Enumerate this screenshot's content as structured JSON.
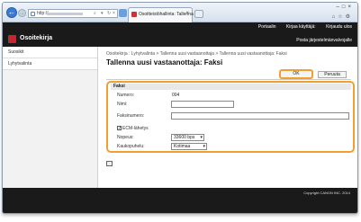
{
  "browser": {
    "address_scheme": "http://",
    "tab_title": "Osoitteistöhallinta: Tallenna ...",
    "icons": [
      "back-icon",
      "forward-icon",
      "close-icon",
      "home-icon",
      "star-icon",
      "gear-icon"
    ]
  },
  "header": {
    "top_links": [
      "Portaalin",
      "Kirjaa käyttäjä:",
      "Kirjaudu ulos"
    ],
    "app_title": "Osoitekirja",
    "top_right": "Posta järjestelmänvalvojalle"
  },
  "sidebar": {
    "items": [
      {
        "label": "Suosikit"
      },
      {
        "label": "Lyhytvalinta"
      }
    ]
  },
  "main": {
    "breadcrumb": "Osoitekirja : Lyhytvalinta > Tallenna uusi vastaanottaja > Tallenna uusi vastaanottaja: Faksi",
    "title": "Tallenna uusi vastaanottaja: Faksi",
    "ok_label": "OK",
    "cancel_label": "Peruuta",
    "section": {
      "title": "Faksi",
      "number_label": "Numero:",
      "number_value": "004",
      "name_label": "Nimi:",
      "name_value": "",
      "fax_label": "Faksinumero:",
      "fax_value": "",
      "ecm_label": "ECM-lähetys",
      "ecm_checked": true,
      "speed_label": "Nopeus:",
      "speed_value": "33600 bps",
      "distance_label": "Kaukopuhelu:",
      "distance_value": "Kotimaa"
    }
  },
  "footer": {
    "copyright": "Copyright CANON INC. 2014"
  }
}
